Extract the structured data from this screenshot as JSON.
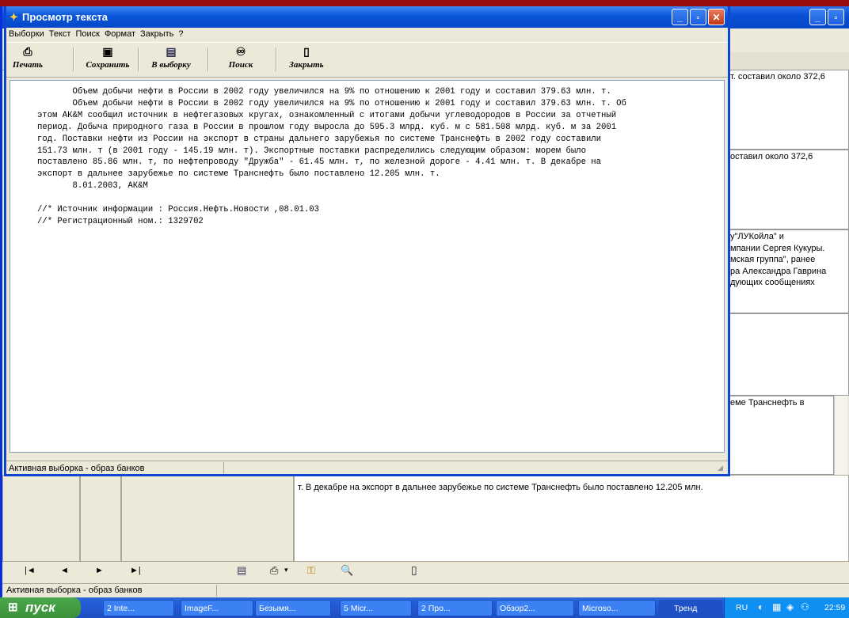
{
  "background_window": {
    "right_cells": [
      "т. составил около 372,6",
      "оставил около 372,6",
      "у\"ЛУКойла\" и\nмпании Сергея Кукуры.\nмская группа\", ранее\nра Александра Гаврина\nдующих сообщениях",
      "",
      "еме Транснефть в"
    ],
    "lower_text": "т. В декабре на экспорт в дальнее зарубежье по системе Транснефть было поставлено 12.205 млн.",
    "status_text": "Активная выборка - образ банков"
  },
  "dialog": {
    "title": "Просмотр текста",
    "menu": [
      "Выборки",
      "Текст",
      "Поиск",
      "Формат",
      "Закрыть",
      "?"
    ],
    "toolbar": [
      "Печать",
      "Сохранить",
      "В выборку",
      "Поиск",
      "Закрыть"
    ],
    "text": "       Объем добычи нефти в России в 2002 году увеличился на 9% по отношению к 2001 году и составил 379.63 млн. т.\n       Объем добычи нефти в России в 2002 году увеличился на 9% по отношению к 2001 году и составил 379.63 млн. т. Об\nэтом АК&М сообщил источник в нефтегазовых кругах, ознакомленный с итогами добычи углеводородов в России за отчетный\nпериод. Добыча природного газа в России в прошлом году выросла до 595.3 млрд. куб. м с 581.508 млрд. куб. м за 2001\nгод. Поставки нефти из России на экспорт в страны дальнего зарубежья по системе Транснефть в 2002 году составили\n151.73 млн. т (в 2001 году - 145.19 млн. т). Экспортные поставки распределились следующим образом: морем было\nпоставлено 85.86 млн. т, по нефтепроводу \"Дружба\" - 61.45 млн. т, по железной дороге - 4.41 млн. т. В декабре на\nэкспорт в дальнее зарубежье по системе Транснефть было поставлено 12.205 млн. т.\n       8.01.2003, АК&М\n\n//* Источник информации : Россия.Нефть.Новости ,08.01.03\n//* Регистрационный ном.: 1329702",
    "status": "Активная выборка - образ банков"
  },
  "taskbar": {
    "start": "пуск",
    "tasks": [
      "2 Inte...",
      "ImageF...",
      "Безымя...",
      "5 Micr...",
      "2 Про...",
      "Обзор2...",
      "Microso...",
      "Тренд"
    ],
    "lang": "RU",
    "clock": "22:59"
  },
  "colors": {
    "desktop": "#9a0c0c",
    "titlebar": "#0a55d8",
    "window_bg": "#ece9d8"
  }
}
